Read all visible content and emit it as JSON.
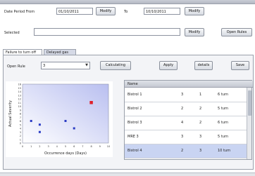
{
  "header": {
    "date_from_label": "Date Period From",
    "date_from_value": "01/10/2011",
    "date_to_label": "To",
    "date_to_value": "10/10/2011",
    "modify_label": "Modify",
    "selected_label": "Selected",
    "selected_value": "",
    "open_rules_label": "Open Rules"
  },
  "tabs": [
    {
      "label": "Failure to turn off"
    },
    {
      "label": "Delayed gas"
    }
  ],
  "toolbar": {
    "rule_label": "Open Rule",
    "rule_value": "3",
    "calculate_label": "Calculating",
    "button_2": "Apply",
    "button_3": "details",
    "button_4": "Save"
  },
  "chart_data": {
    "type": "scatter",
    "xlabel": "Occurrence days (Days)",
    "ylabel": "Actual Severity",
    "xlim": [
      0,
      10
    ],
    "ylim": [
      0,
      16
    ],
    "x_ticks": [
      "0",
      "1",
      "2",
      "3",
      "4",
      "5",
      "6",
      "7",
      "8",
      "9",
      "10"
    ],
    "y_ticks": [
      "0",
      "1",
      "2",
      "3",
      "4",
      "5",
      "6",
      "7",
      "8",
      "9",
      "10",
      "11",
      "12",
      "13",
      "14",
      "15",
      "16"
    ],
    "grid": false,
    "series": [
      {
        "points": [
          [
            1,
            6
          ],
          [
            2,
            5
          ],
          [
            2,
            3
          ],
          [
            5,
            6
          ],
          [
            6,
            4
          ]
        ],
        "color": "#2b3cc4"
      },
      {
        "points": [
          [
            8,
            11
          ]
        ],
        "color": "#e0202a"
      }
    ]
  },
  "table": {
    "columns": [
      "Name",
      "",
      "",
      ""
    ],
    "rows": [
      {
        "name": "Bistrol 1",
        "c1": "3",
        "c2": "1",
        "c3": "6 turn"
      },
      {
        "name": "Bistrol 2",
        "c1": "2",
        "c2": "2",
        "c3": "5 turn"
      },
      {
        "name": "Bistrol 3",
        "c1": "4",
        "c2": "2",
        "c3": "6 turn"
      },
      {
        "name": "MRE 3",
        "c1": "3",
        "c2": "3",
        "c3": "5 turn"
      },
      {
        "name": "Bistrol 4",
        "c1": "2",
        "c2": "3",
        "c3": "10 turn"
      }
    ],
    "selected_row": 4
  }
}
